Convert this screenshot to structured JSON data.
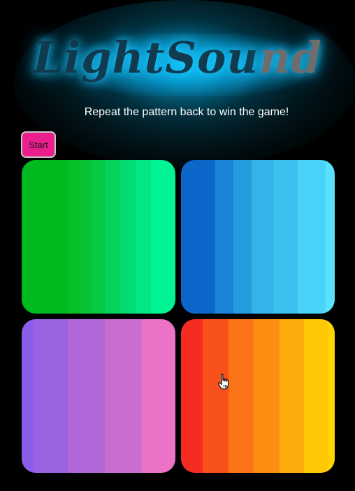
{
  "logo": {
    "dark_part": "LightSou",
    "grey_part": "nd"
  },
  "subtitle": "Repeat the pattern back to win the game!",
  "start_button": {
    "label": "Start",
    "color": "#ea1e8c"
  },
  "pads": [
    {
      "color": "green",
      "base": "#00ba1f",
      "highlight": "#00f493"
    },
    {
      "color": "blue",
      "base": "#0d66c9",
      "highlight": "#59e1fd"
    },
    {
      "color": "purple",
      "base": "#8a5ee8",
      "highlight": "#ec72c8"
    },
    {
      "color": "orange",
      "base": "#f42c21",
      "highlight": "#ffd500"
    }
  ],
  "cursor": "hand-pointer-icon"
}
